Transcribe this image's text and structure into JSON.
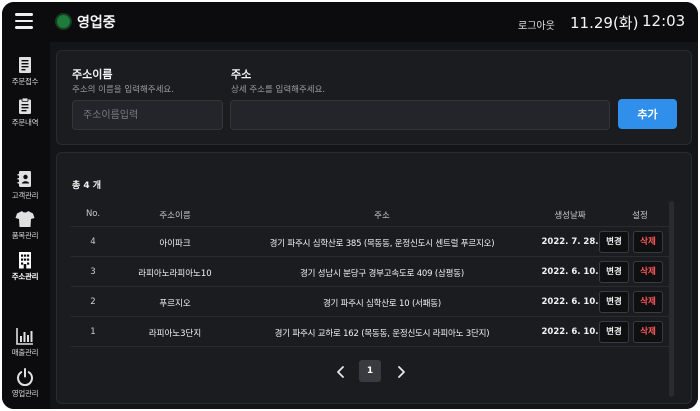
{
  "header": {
    "status": "영업중",
    "logout": "로그아웃",
    "date": "11.29(화)",
    "time": "12:03",
    "status_color": "#1f7a3c"
  },
  "sidebar": {
    "items": [
      {
        "label": "주문접수",
        "icon": "order-receipt-icon"
      },
      {
        "label": "주문내역",
        "icon": "clipboard-icon"
      },
      {
        "label": "고객관리",
        "icon": "contact-book-icon"
      },
      {
        "label": "품목관리",
        "icon": "shirt-icon"
      },
      {
        "label": "주소관리",
        "icon": "building-icon",
        "active": true
      },
      {
        "label": "매출관리",
        "icon": "bar-chart-icon"
      },
      {
        "label": "영업관리",
        "icon": "power-icon"
      }
    ]
  },
  "form": {
    "name_title": "주소이름",
    "name_desc": "주소의 이름을 입력해주세요.",
    "name_placeholder": "주소이름입력",
    "addr_title": "주소",
    "addr_desc": "상세 주소를 입력해주세요.",
    "addr_placeholder": "",
    "add_label": "추가",
    "accent": "#2f8fea"
  },
  "list": {
    "total": "총 4 개",
    "headers": {
      "no": "No.",
      "name": "주소이름",
      "addr": "주소",
      "date": "생성날짜",
      "set": "설정"
    },
    "change_label": "변경",
    "delete_label": "삭제",
    "rows": [
      {
        "no": "4",
        "name": "아이파크",
        "addr": "경기 파주시 심학산로 385 (목동동, 운정신도시 센트럴 푸르지오)",
        "date": "2022. 7. 28."
      },
      {
        "no": "3",
        "name": "라피아노라피아노10",
        "addr": "경기 성남시 분당구 경부고속도로 409 (삼평동)",
        "date": "2022. 6. 10."
      },
      {
        "no": "2",
        "name": "푸르지오",
        "addr": "경기 파주시 심학산로 10 (서패동)",
        "date": "2022. 6. 10."
      },
      {
        "no": "1",
        "name": "라피아노3단지",
        "addr": "경기 파주시 교하로 162 (목동동, 운정신도시 라피아노 3단지)",
        "date": "2022. 6. 10."
      }
    ]
  },
  "pager": {
    "current": "1"
  }
}
